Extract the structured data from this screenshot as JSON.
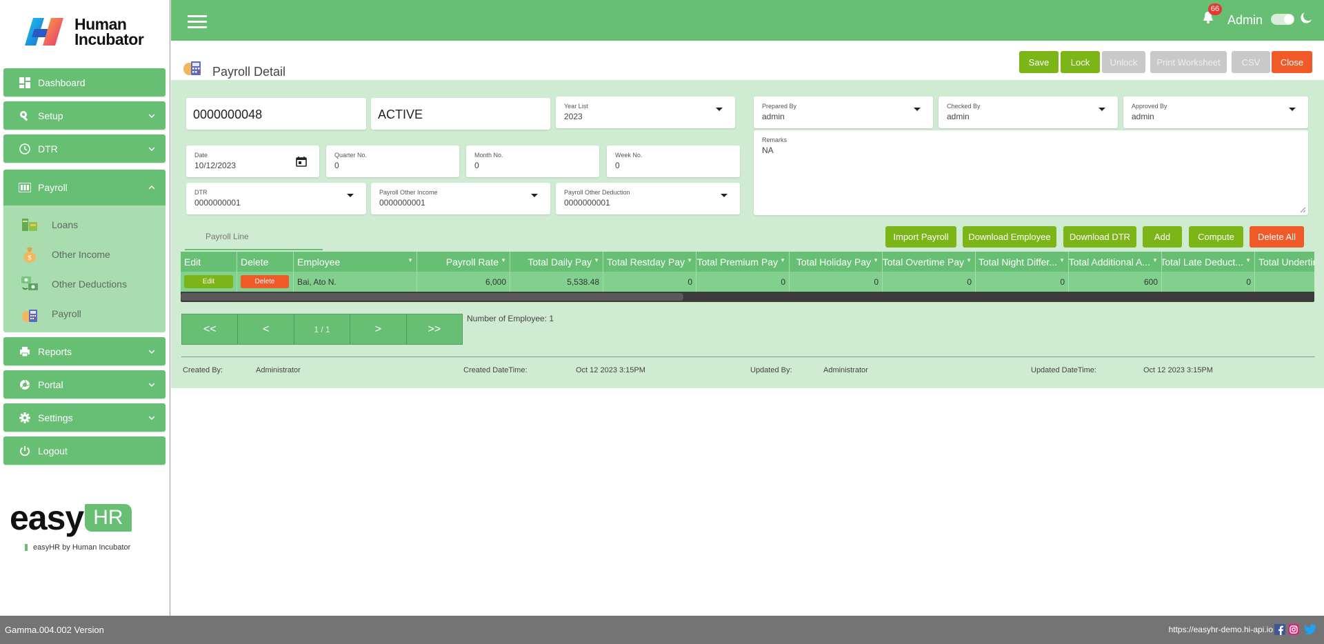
{
  "brand": {
    "name_line1": "Human",
    "name_line2": "Incubator"
  },
  "sidebar": {
    "items": [
      {
        "label": "Dashboard",
        "icon": "dashboard-icon"
      },
      {
        "label": "Setup",
        "icon": "wrench-icon"
      },
      {
        "label": "DTR",
        "icon": "clock-icon"
      },
      {
        "label": "Payroll",
        "icon": "payroll-icon"
      },
      {
        "label": "Reports",
        "icon": "printer-icon"
      },
      {
        "label": "Portal",
        "icon": "aperture-icon"
      },
      {
        "label": "Settings",
        "icon": "gear-icon"
      },
      {
        "label": "Logout",
        "icon": "power-icon"
      }
    ],
    "payroll_sub": [
      {
        "label": "Loans",
        "icon": "loans-icon"
      },
      {
        "label": "Other Income",
        "icon": "money-bag-icon"
      },
      {
        "label": "Other Deductions",
        "icon": "deductions-icon"
      },
      {
        "label": "Payroll",
        "icon": "calculator-icon"
      }
    ],
    "easyhr_big": "easy",
    "easyhr_hr": "HR",
    "easyhr_by": "easyHR by Human Incubator"
  },
  "topbar": {
    "notifications": "66",
    "user": "Admin"
  },
  "page": {
    "title": "Payroll Detail",
    "buttons": {
      "save": "Save",
      "lock": "Lock",
      "unlock": "Unlock",
      "print": "Print Worksheet",
      "csv": "CSV",
      "close": "Close"
    }
  },
  "form": {
    "payroll_no": "0000000048",
    "status": "ACTIVE",
    "year_list_label": "Year List",
    "year_list": "2023",
    "prepared_by_label": "Prepared By",
    "prepared_by": "admin",
    "checked_by_label": "Checked By",
    "checked_by": "admin",
    "approved_by_label": "Approved By",
    "approved_by": "admin",
    "date_label": "Date",
    "date": "10/12/2023",
    "quarter_label": "Quarter No.",
    "quarter": "0",
    "month_label": "Month No.",
    "month": "0",
    "week_label": "Week No.",
    "week": "0",
    "remarks_label": "Remarks",
    "remarks": "NA",
    "dtr_label": "DTR",
    "dtr": "0000000001",
    "other_income_label": "Payroll Other Income",
    "other_income": "0000000001",
    "other_deduction_label": "Payroll Other Deduction",
    "other_deduction": "0000000001"
  },
  "tab": {
    "label": "Payroll Line"
  },
  "line_buttons": {
    "import": "Import Payroll",
    "download_emp": "Download Employee",
    "download_dtr": "Download DTR",
    "add": "Add",
    "compute": "Compute",
    "delete_all": "Delete All"
  },
  "grid": {
    "headers": [
      "Edit",
      "Delete",
      "Employee",
      "Payroll Rate",
      "Total Daily Pay",
      "Total Restday Pay",
      "Total Premium Pay",
      "Total Holiday Pay",
      "Total Overtime Pay",
      "Total Night Differ...",
      "Total Additional A...",
      "Total Late Deduct...",
      "Total Undertim"
    ],
    "row": {
      "edit": "Edit",
      "delete": "Delete",
      "employee": "Bai, Ato N.",
      "values": [
        "6,000",
        "5,538.48",
        "0",
        "0",
        "0",
        "0",
        "0",
        "600",
        "0",
        ""
      ]
    }
  },
  "pager": {
    "first": "<<",
    "prev": "<",
    "page": "1 / 1",
    "next": ">",
    "last": ">>"
  },
  "employee_count": "Number of Employee: 1",
  "meta": {
    "created_by_label": "Created By:",
    "created_by": "Administrator",
    "created_dt_label": "Created DateTime:",
    "created_dt": "Oct 12 2023 3:15PM",
    "updated_by_label": "Updated By:",
    "updated_by": "Administrator",
    "updated_dt_label": "Updated DateTime:",
    "updated_dt": "Oct 12 2023 3:15PM"
  },
  "footer": {
    "version": "Gamma.004.002 Version",
    "url": "https://easyhr-demo.hi-api.io"
  },
  "colors": {
    "primary": "#66bf72",
    "lime": "#7cb518",
    "danger": "#f05a28",
    "disabled": "#c9c9c9",
    "panel": "#cfecd2"
  }
}
